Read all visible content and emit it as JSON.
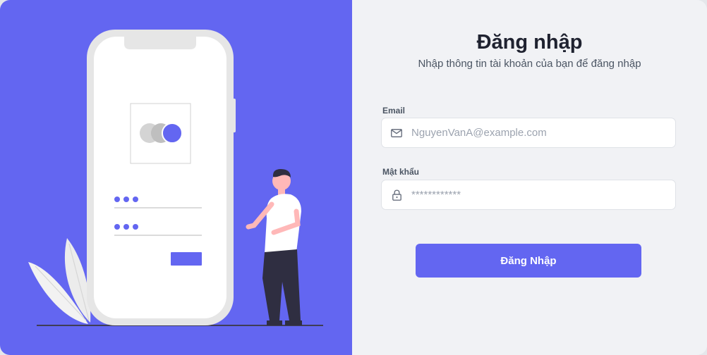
{
  "login": {
    "title": "Đăng nhập",
    "subtitle": "Nhập thông tin tài khoản của bạn để đăng nhập",
    "email": {
      "label": "Email",
      "placeholder": "NguyenVanA@example.com",
      "value": "",
      "icon": "mail-icon"
    },
    "password": {
      "label": "Mật khẩu",
      "placeholder": "************",
      "value": "",
      "icon": "lock-icon"
    },
    "submit_label": "Đăng Nhập"
  },
  "colors": {
    "accent": "#6366f1",
    "panel_bg": "#f1f2f5"
  }
}
